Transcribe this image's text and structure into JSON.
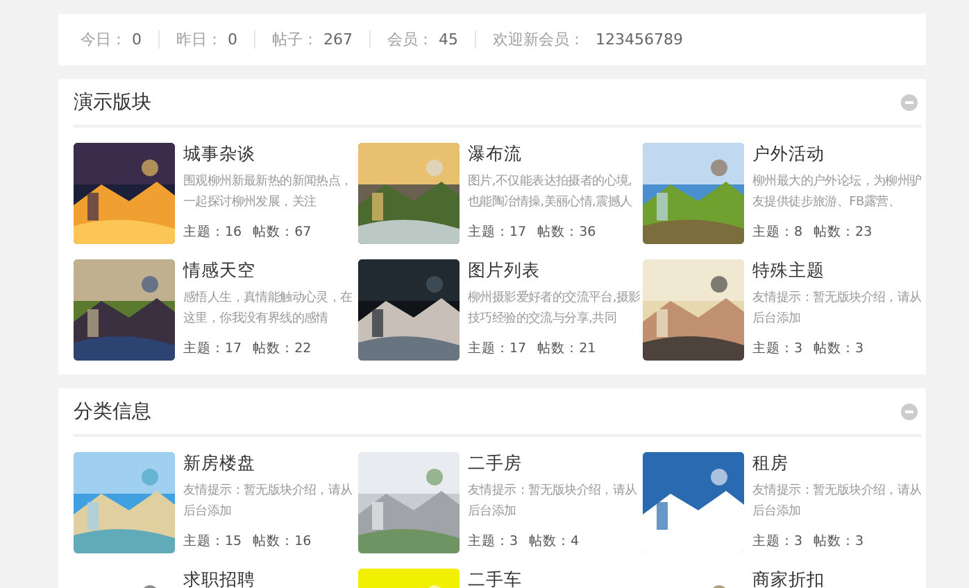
{
  "stats": [
    {
      "label": "今日：",
      "value": "0"
    },
    {
      "label": "昨日：",
      "value": "0"
    },
    {
      "label": "帖子：",
      "value": "267"
    },
    {
      "label": "会员：",
      "value": "45"
    },
    {
      "label": "欢迎新会员：",
      "value": "123456789"
    }
  ],
  "sections": [
    {
      "title": "演示版块",
      "expanded": true,
      "forums": [
        {
          "title": "城事杂谈",
          "desc": "围观柳州新最新热的新闻热点，一起探讨柳州发展，关注",
          "topics": "主题：16",
          "posts": "帖数：67"
        },
        {
          "title": "瀑布流",
          "desc": "图片,不仅能表达拍摄者的心境,也能陶冶情操,美丽心情,震撼人",
          "topics": "主题：17",
          "posts": "帖数：36"
        },
        {
          "title": "户外活动",
          "desc": "柳州最大的户外论坛，为柳州驴友提供徒步旅游、FB露营、",
          "topics": "主题：8",
          "posts": "帖数：23"
        },
        {
          "title": "情感天空",
          "desc": "感悟人生，真情能触动心灵，在这里，你我没有界线的感情",
          "topics": "主题：17",
          "posts": "帖数：22"
        },
        {
          "title": "图片列表",
          "desc": "柳州摄影爱好者的交流平台,摄影技巧经验的交流与分享,共同",
          "topics": "主题：17",
          "posts": "帖数：21"
        },
        {
          "title": "特殊主题",
          "desc": "友情提示：暂无版块介绍，请从后台添加",
          "topics": "主题：3",
          "posts": "帖数：3"
        }
      ]
    },
    {
      "title": "分类信息",
      "expanded": true,
      "forums": [
        {
          "title": "新房楼盘",
          "desc": "友情提示：暂无版块介绍，请从后台添加",
          "topics": "主题：15",
          "posts": "帖数：16"
        },
        {
          "title": "二手房",
          "desc": "友情提示：暂无版块介绍，请从后台添加",
          "topics": "主题：3",
          "posts": "帖数：4"
        },
        {
          "title": "租房",
          "desc": "友情提示：暂无版块介绍，请从后台添加",
          "topics": "主题：3",
          "posts": "帖数：3"
        },
        {
          "title": "求职招聘"
        },
        {
          "title": "二手车"
        },
        {
          "title": "商家折扣"
        }
      ]
    }
  ]
}
